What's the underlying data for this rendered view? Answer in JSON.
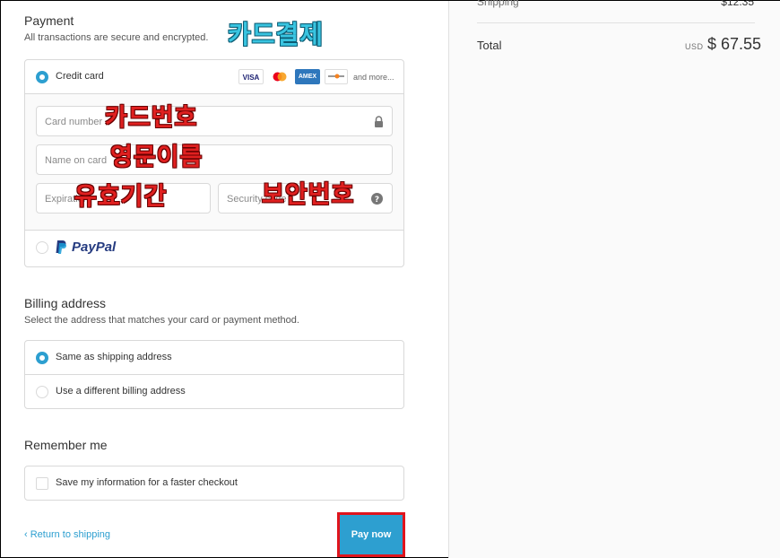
{
  "payment": {
    "title": "Payment",
    "subtitle": "All transactions are secure and encrypted.",
    "credit_card_label": "Credit card",
    "card_logos": [
      "VISA",
      "AMEX"
    ],
    "and_more": "and more...",
    "card_number_placeholder": "Card number",
    "name_on_card_placeholder": "Name on card",
    "expiration_placeholder": "Expiration",
    "security_code_placeholder": "Security code",
    "paypal_label": "PayPal"
  },
  "annotations": {
    "card_payment": "카드결제",
    "card_number": "카드번호",
    "english_name": "영문이름",
    "expiry": "유효기간",
    "security": "보안번호"
  },
  "billing": {
    "title": "Billing address",
    "subtitle": "Select the address that matches your card or payment method.",
    "options": [
      "Same as shipping address",
      "Use a different billing address"
    ],
    "selected_index": 0
  },
  "remember": {
    "title": "Remember me",
    "checkbox_label": "Save my information for a faster checkout"
  },
  "footer": {
    "return_link": "Return to shipping",
    "pay_button": "Pay now"
  },
  "summary": {
    "shipping_label": "Shipping",
    "shipping_value": "$12.35",
    "total_label": "Total",
    "currency": "USD",
    "total_value": "$ 67.55"
  },
  "colors": {
    "accent": "#2d9fd0",
    "highlight": "#e0141c",
    "overlay_text": "#e02020",
    "overlay_title": "#39c4e0"
  }
}
